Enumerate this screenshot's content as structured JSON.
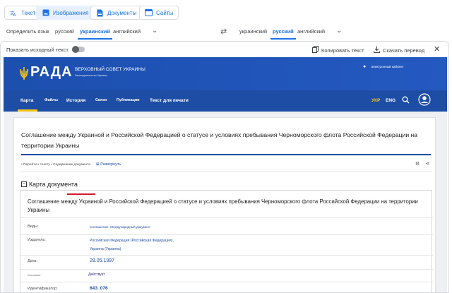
{
  "modes": [
    {
      "label": "Текст",
      "icon": "translate-icon"
    },
    {
      "label": "Изображения",
      "icon": "image-icon"
    },
    {
      "label": "Документы",
      "icon": "document-icon"
    },
    {
      "label": "Сайты",
      "icon": "website-icon"
    }
  ],
  "source_langs": [
    "Определить язык",
    "русский",
    "украинский",
    "английский"
  ],
  "target_langs": [
    "украинский",
    "русский",
    "английский"
  ],
  "panel": {
    "show_original": "Показать исходный текст",
    "copy": "Копировать текст",
    "download": "Скачать перевод"
  },
  "site": {
    "logo": "РАДА",
    "org_name": "ВЕРХОВНЫЙ СОВЕТ УКРАИНЫ",
    "org_sub": "Законодательство Украины",
    "cabinet": "Электронный кабинет",
    "nav": [
      "Карта",
      "Файлы",
      "История",
      "Связи",
      "Публикации",
      "Текст для печати"
    ],
    "lang_ukr": "УКР",
    "lang_eng": "ENG",
    "doc_title": "Соглашение между Украиной и Российской Федерацией о статусе и условиях пребывания Черноморского флота Российской Федерации на территории Украины",
    "crumbs": "• Перейти к тексту • Содержание документа",
    "expand": "Развернуть",
    "map_heading": "Карта документа",
    "map_title": "Соглашение между Украиной и Российской Федерацией о статусе и условиях пребывания Черноморского флота Российской Федерации на территории Украины",
    "rows": {
      "kinds_label": "Виды:",
      "kinds_value": "Соглашение, Международный документ",
      "publisher_label": "Издатель:",
      "publisher_value_1": "Российская Федерация (Российская Федерация),",
      "publisher_value_2": "Украина (Украина)",
      "date_label": "Дата:",
      "date_value": "28.05.1997",
      "status_label": "Состояние:",
      "status_value": "Действует",
      "id_label": "Идентификатор:",
      "id_value": "643_076"
    }
  },
  "colors": {
    "accent": "#1a73e8",
    "rada_blue": "#1d4da4",
    "underline_red": "#d11a2a",
    "nav_yellow": "#f5c518"
  }
}
